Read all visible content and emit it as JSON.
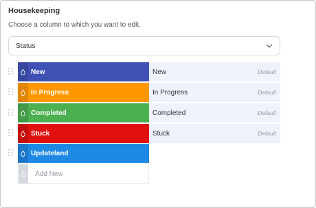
{
  "panel": {
    "title": "Housekeeping",
    "subtitle": "Choose a column to which you want to edit.",
    "column_select": {
      "value": "Status"
    }
  },
  "labels": [
    {
      "name": "New",
      "color": "#3f51b5",
      "mapped": "New",
      "tag": "Default"
    },
    {
      "name": "In Progress",
      "color": "#ff9800",
      "mapped": "In Progress",
      "tag": "Default"
    },
    {
      "name": "Completed",
      "color": "#4caf50",
      "mapped": "Completed",
      "tag": "Default"
    },
    {
      "name": "Stuck",
      "color": "#e01010",
      "mapped": "Stuck",
      "tag": "Default"
    },
    {
      "name": "Updateland",
      "color": "#1e88e5",
      "mapped": "",
      "tag": ""
    }
  ],
  "add_new": {
    "label": "Add New"
  },
  "icons": {
    "drag": "drag-handle-icon",
    "drop": "paint-drop-icon",
    "chevron": "chevron-down-icon"
  }
}
